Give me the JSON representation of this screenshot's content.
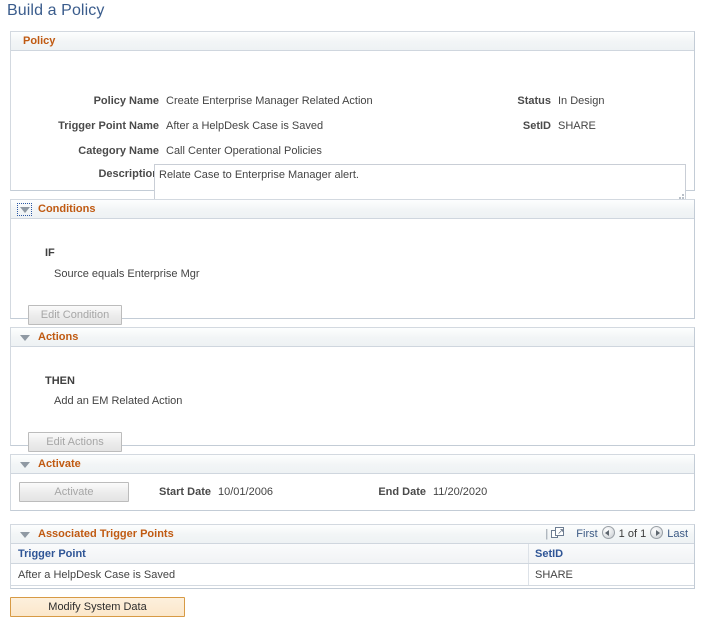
{
  "page": {
    "title": "Build a Policy"
  },
  "policy_section": {
    "title": "Policy",
    "fields": {
      "policy_name_label": "Policy Name",
      "policy_name_value": "Create Enterprise Manager Related Action",
      "trigger_point_name_label": "Trigger Point Name",
      "trigger_point_name_value": "After a HelpDesk Case is Saved",
      "category_name_label": "Category Name",
      "category_name_value": "Call Center Operational Policies",
      "description_label": "Description",
      "description_value": "Relate Case to Enterprise Manager alert.",
      "status_label": "Status",
      "status_value": "In Design",
      "setid_label": "SetID",
      "setid_value": "SHARE"
    }
  },
  "conditions_section": {
    "title": "Conditions",
    "keyword": "IF",
    "expression": "Source equals Enterprise Mgr",
    "edit_button": "Edit Condition"
  },
  "actions_section": {
    "title": "Actions",
    "keyword": "THEN",
    "expression": "Add an EM Related Action",
    "edit_button": "Edit Actions"
  },
  "activate_section": {
    "title": "Activate",
    "activate_button": "Activate",
    "start_date_label": "Start Date",
    "start_date_value": "10/01/2006",
    "end_date_label": "End Date",
    "end_date_value": "11/20/2020"
  },
  "trigger_points_section": {
    "title": "Associated Trigger Points",
    "nav": {
      "separator": "|",
      "new_window_icon": "open-in-new-window-icon",
      "first_label": "First",
      "prev_icon": "previous-page-icon",
      "page_counter": "1 of 1",
      "next_icon": "next-page-icon",
      "last_label": "Last"
    },
    "columns": [
      "Trigger Point",
      "SetID"
    ],
    "rows": [
      {
        "trigger_point": "After a HelpDesk Case is Saved",
        "setid": "SHARE"
      }
    ]
  },
  "footer": {
    "modify_button": "Modify System Data"
  },
  "colors": {
    "page_title": "#3a5c8c",
    "section_title": "#c05a12",
    "grid_header_text": "#2f5596",
    "modify_button_bg": "#fbe7cb",
    "modify_button_border": "#d79a45"
  }
}
